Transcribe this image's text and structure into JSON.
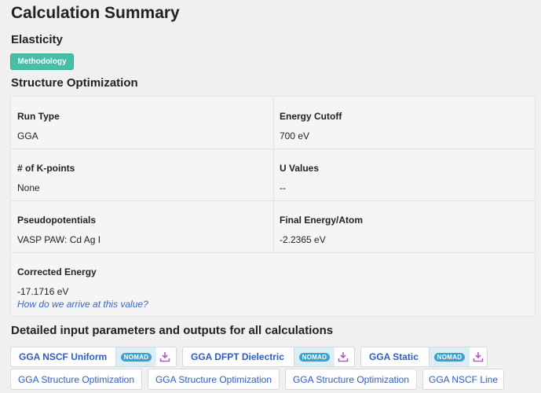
{
  "page": {
    "title": "Calculation Summary"
  },
  "elasticity": {
    "heading": "Elasticity",
    "methodology_label": "Methodology"
  },
  "structure_optimization": {
    "heading": "Structure Optimization",
    "rows": [
      {
        "label": "Run Type",
        "value": "GGA"
      },
      {
        "label": "Energy Cutoff",
        "value": "700 eV"
      },
      {
        "label": "# of K-points",
        "value": "None"
      },
      {
        "label": "U Values",
        "value": "--"
      },
      {
        "label": "Pseudopotentials",
        "value": "VASP PAW: Cd Ag I"
      },
      {
        "label": "Final Energy/Atom",
        "value": "-2.2365 eV"
      },
      {
        "label": "Corrected Energy",
        "value": "-17.1716 eV"
      }
    ],
    "corrected_energy_link": "How do we arrive at this value?"
  },
  "detailed": {
    "heading": "Detailed input parameters and outputs for all calculations",
    "nomad_text": "NOMAD",
    "nomad_buttons": [
      {
        "label": "GGA NSCF Uniform"
      },
      {
        "label": "GGA DFPT Dielectric"
      },
      {
        "label": "GGA Static"
      }
    ],
    "plain_buttons": [
      {
        "label": "GGA Structure Optimization"
      },
      {
        "label": "GGA Structure Optimization"
      },
      {
        "label": "GGA Structure Optimization"
      },
      {
        "label": "GGA NSCF Line"
      }
    ]
  },
  "colors": {
    "accent_teal": "#46bfa9",
    "link_blue": "#2f5cc0",
    "nomad_blue": "#3fa0d0",
    "download_purple": "#b05cc0"
  },
  "icons": {
    "nomad": "nomad-logo-icon",
    "download": "download-icon"
  }
}
